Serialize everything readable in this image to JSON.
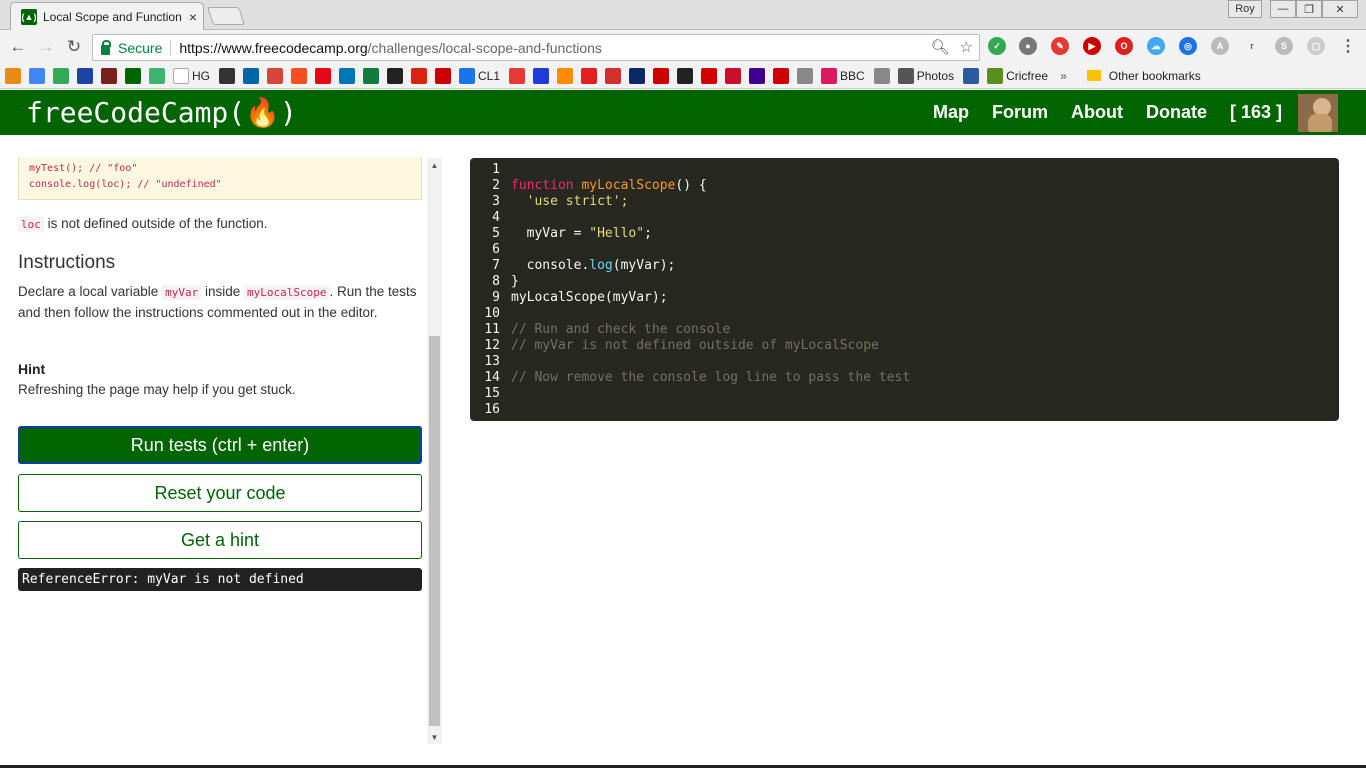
{
  "browser": {
    "tab_title": "Local Scope and Function",
    "tab_close": "×",
    "profile": "Roy",
    "win_minimize": "—",
    "win_restore": "❐",
    "win_close": "✕",
    "secure_label": "Secure",
    "url_host": "https://www.freecodecamp.org",
    "url_path": "/challenges/local-scope-and-functions",
    "bookmarks": [
      {
        "icon": "#e98a15",
        "label": ""
      },
      {
        "icon": "#4285f4",
        "label": ""
      },
      {
        "icon": "#34a853",
        "label": ""
      },
      {
        "icon": "#1c44a5",
        "label": ""
      },
      {
        "icon": "#7a1f1f",
        "label": ""
      },
      {
        "icon": "#006400",
        "label": ""
      },
      {
        "icon": "#3cb371",
        "label": ""
      },
      {
        "icon": "#ffffff",
        "label": "HG"
      },
      {
        "icon": "#333333",
        "label": ""
      },
      {
        "icon": "#0066aa",
        "label": ""
      },
      {
        "icon": "#d44638",
        "label": ""
      },
      {
        "icon": "#f25022",
        "label": ""
      },
      {
        "icon": "#e50914",
        "label": ""
      },
      {
        "icon": "#0077b5",
        "label": ""
      },
      {
        "icon": "#107c41",
        "label": ""
      },
      {
        "icon": "#222222",
        "label": ""
      },
      {
        "icon": "#d9230f",
        "label": ""
      },
      {
        "icon": "#cc0000",
        "label": ""
      },
      {
        "icon": "#1a73e8",
        "label": "CL1"
      },
      {
        "icon": "#e53935",
        "label": ""
      },
      {
        "icon": "#1f3bd6",
        "label": ""
      },
      {
        "icon": "#ff8c00",
        "label": ""
      },
      {
        "icon": "#e02020",
        "label": ""
      },
      {
        "icon": "#d32f2f",
        "label": ""
      },
      {
        "icon": "#0a2a66",
        "label": ""
      },
      {
        "icon": "#cc0000",
        "label": ""
      },
      {
        "icon": "#222222",
        "label": ""
      },
      {
        "icon": "#d40000",
        "label": ""
      },
      {
        "icon": "#c8102e",
        "label": ""
      },
      {
        "icon": "#400090",
        "label": ""
      },
      {
        "icon": "#cc0000",
        "label": ""
      },
      {
        "icon": "#888888",
        "label": ""
      },
      {
        "icon": "#d81b60",
        "label": "BBC"
      },
      {
        "icon": "#888888",
        "label": ""
      },
      {
        "icon": "#555555",
        "label": "Photos"
      },
      {
        "icon": "#2c5aa0",
        "label": ""
      },
      {
        "icon": "#5b8d1f",
        "label": "Cricfree"
      }
    ],
    "bookmarks_more": "»",
    "other_bookmarks": "Other bookmarks"
  },
  "fcc": {
    "logo": "freeCodeCamp(🔥)",
    "nav": [
      "Map",
      "Forum",
      "About",
      "Donate",
      "[ 163 ]"
    ]
  },
  "challenge": {
    "snippet_line1": "myTest(); // \"foo\"",
    "snippet_line2": "console.log(loc); // \"undefined\"",
    "loc_code": "loc",
    "loc_text": " is not defined outside of the function.",
    "instructions_heading": "Instructions",
    "instr_part1": "Declare a local variable ",
    "instr_code1": "myVar",
    "instr_part2": " inside ",
    "instr_code2": "myLocalScope",
    "instr_part3": ". Run the tests and then follow the instructions commented out in the editor.",
    "hint_title": "Hint",
    "hint_text": "Refreshing the page may help if you get stuck.",
    "run_button": "Run tests (ctrl + enter)",
    "reset_button": "Reset your code",
    "hint_button": "Get a hint",
    "error_output": "ReferenceError: myVar is not defined"
  },
  "editor": {
    "line_numbers": [
      "1",
      "2",
      "3",
      "4",
      "5",
      "6",
      "7",
      "8",
      "9",
      "10",
      "11",
      "12",
      "13",
      "14",
      "15",
      "16"
    ],
    "l2_kw": "function",
    "l2_fn": "myLocalScope",
    "l2_rest": "() {",
    "l3": "  'use strict';",
    "l5_a": "  myVar = ",
    "l5_str": "\"Hello\"",
    "l5_b": ";",
    "l7_a": "  console.",
    "l7_m": "log",
    "l7_b": "(myVar);",
    "l8": "}",
    "l9": "myLocalScope(myVar);",
    "l11": "// Run and check the console",
    "l12": "// myVar is not defined outside of myLocalScope",
    "l14": "// Now remove the console log line to pass the test"
  }
}
